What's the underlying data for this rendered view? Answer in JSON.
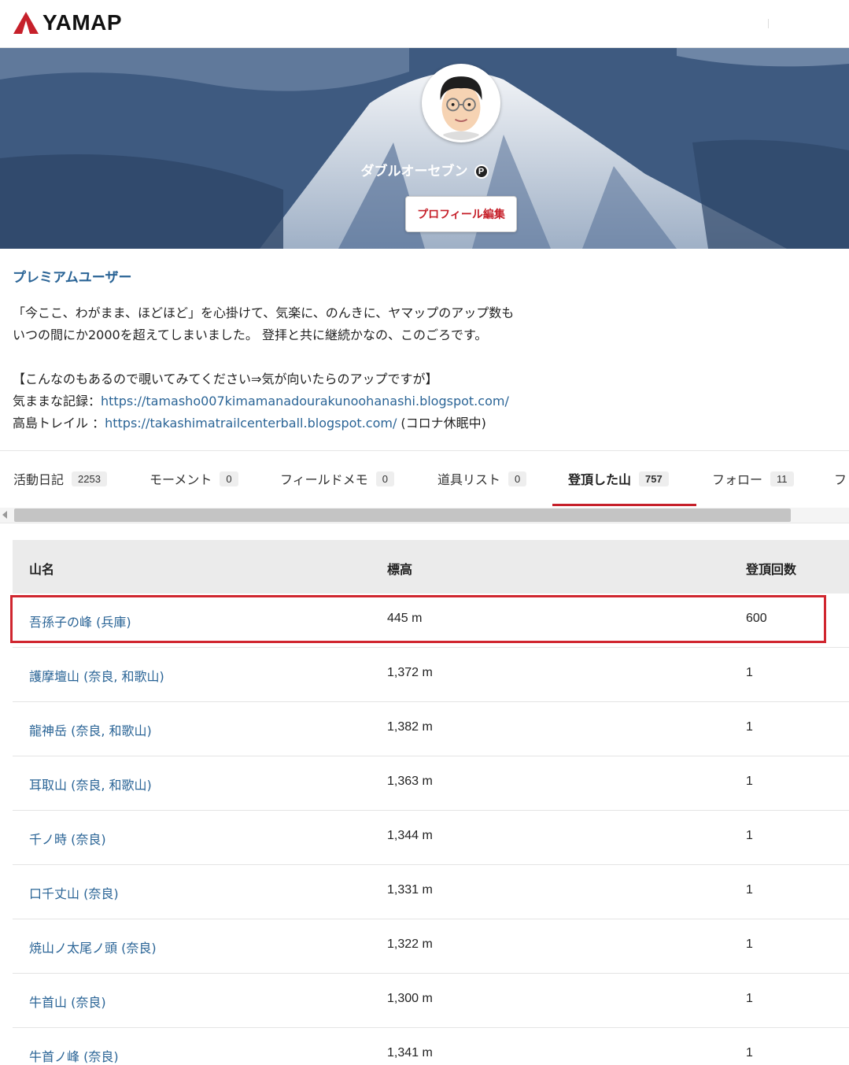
{
  "header": {
    "logo_text": "YAMAP",
    "logo_icon": "yamap-triangle-icon",
    "brand_color": "#c6202a"
  },
  "profile": {
    "username": "ダブルオーセブン",
    "premium_badge": "P",
    "edit_button": "プロフィール編集",
    "premium_label": "プレミアムユーザー",
    "bio_lines": [
      "「今ここ、わがまま、ほどほど」を心掛けて、気楽に、のんきに、ヤマップのアップ数も",
      "いつの間にか2000を超えてしまいました。 登拝と共に継続かなの、このごろです。"
    ],
    "bio_note": "【こんなのもあるので覗いてみてください⇒気が向いたらのアップですが】",
    "links": [
      {
        "label": "気ままな記録：",
        "url": "https://tamasho007kimamanadourakunoohanashi.blogspot.com/",
        "suffix": ""
      },
      {
        "label": "高島トレイル ：",
        "url": "https://takashimatrailcenterball.blogspot.com/",
        "suffix": " (コロナ休眠中)"
      }
    ]
  },
  "tabs": [
    {
      "label": "活動日記",
      "count": "2253"
    },
    {
      "label": "モーメント",
      "count": "0"
    },
    {
      "label": "フィールドメモ",
      "count": "0"
    },
    {
      "label": "道具リスト",
      "count": "0"
    },
    {
      "label": "登頂した山",
      "count": "757"
    },
    {
      "label": "フォロー",
      "count": "11"
    },
    {
      "label": "フ",
      "count": ""
    }
  ],
  "table": {
    "headers": {
      "name": "山名",
      "elevation": "標高",
      "count": "登頂回数"
    },
    "rows": [
      {
        "name": "吾孫子の峰 (兵庫)",
        "elevation": "445 m",
        "count": "600"
      },
      {
        "name": "護摩壇山 (奈良, 和歌山)",
        "elevation": "1,372 m",
        "count": "1"
      },
      {
        "name": "龍神岳 (奈良, 和歌山)",
        "elevation": "1,382 m",
        "count": "1"
      },
      {
        "name": "耳取山 (奈良, 和歌山)",
        "elevation": "1,363 m",
        "count": "1"
      },
      {
        "name": "千ノ時 (奈良)",
        "elevation": "1,344 m",
        "count": "1"
      },
      {
        "name": "口千丈山 (奈良)",
        "elevation": "1,331 m",
        "count": "1"
      },
      {
        "name": "焼山ノ太尾ノ頭 (奈良)",
        "elevation": "1,322 m",
        "count": "1"
      },
      {
        "name": "牛首山 (奈良)",
        "elevation": "1,300 m",
        "count": "1"
      },
      {
        "name": "牛首ノ峰 (奈良)",
        "elevation": "1,341 m",
        "count": "1"
      }
    ]
  }
}
